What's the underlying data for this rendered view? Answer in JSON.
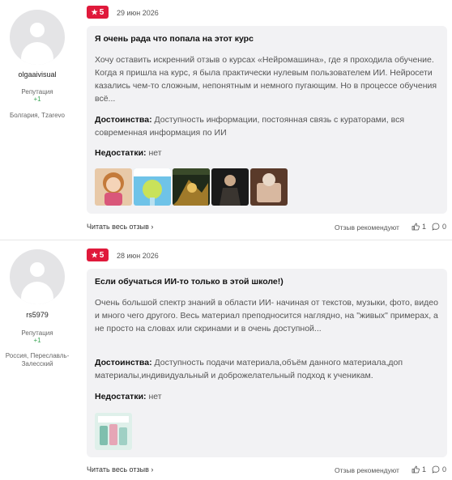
{
  "reviews": [
    {
      "author": {
        "username": "olgaaivisual",
        "rep_label": "Репутация",
        "rep_value": "+1",
        "location": "Болгария, Tzarevo"
      },
      "rating": "5",
      "date": "29 июн 2026",
      "title": "Я очень рада что попала на этот курс",
      "text": "Хочу оставить искренний отзыв о курсах «Нейромашина», где я проходила обучение. Когда я пришла на курс, я была практически нулевым пользователем ИИ. Нейросети казались чем-то сложным, непонятным и немного пугающим. Но в процессе обучения всё...",
      "pros_label": "Достоинства:",
      "pros": "Доступность информации, постоянная связь с кураторами, вся современная информация по ИИ",
      "cons_label": "Недостатки:",
      "cons": "нет",
      "read_more": "Читать весь отзыв",
      "recommend": "Отзыв рекомендуют",
      "likes": "1",
      "comments": "0"
    },
    {
      "author": {
        "username": "rs5979",
        "rep_label": "Репутация",
        "rep_value": "+1",
        "location": "Россия, Переславль-Залесский"
      },
      "rating": "5",
      "date": "28 июн 2026",
      "title": "Если обучаться ИИ-то только в этой школе!)",
      "text": "Очень большой спектр знаний в области ИИ- начиная от текстов, музыки, фото, видео и много чего другого. Весь материал преподносится наглядно, на \"живых\" примерах, а не просто на словах или скринами и в очень доступной...",
      "pros_label": "Достоинства:",
      "pros": "Доступность подачи материала,объём данного материала,доп материалы,индивидуальный и доброжелательный подход к ученикам.",
      "cons_label": "Недостатки:",
      "cons": "нет",
      "read_more": "Читать весь отзыв",
      "recommend": "Отзыв рекомендуют",
      "likes": "1",
      "comments": "0"
    }
  ],
  "icons": {
    "star": "star-icon",
    "chevron": "chevron-right-icon",
    "like": "thumbs-up-icon",
    "comment": "comment-icon"
  },
  "colors": {
    "badge": "#e0193b",
    "reputation": "#3aa655",
    "card": "#f2f2f4"
  }
}
